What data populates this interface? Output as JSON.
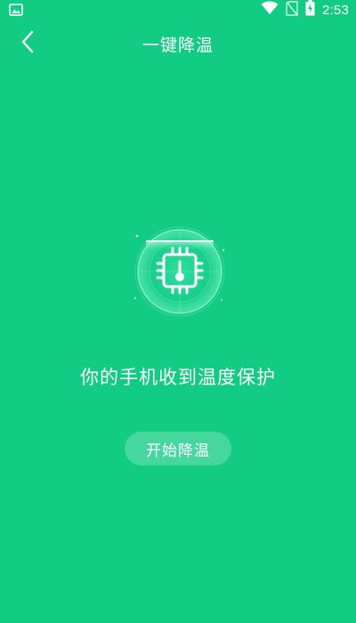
{
  "status_bar": {
    "time": "2:53",
    "icons": [
      "image-icon",
      "wifi-icon",
      "no-sim-icon",
      "battery-charging-icon"
    ]
  },
  "header": {
    "title": "一键降温",
    "back_icon": "chevron-left-icon"
  },
  "main": {
    "graphic_icon": "cpu-thermometer-icon",
    "message": "你的手机收到温度保护",
    "start_button_label": "开始降温"
  },
  "colors": {
    "background": "#12cc84",
    "accent_glow": "#7af5c6",
    "text": "#ffffff"
  }
}
